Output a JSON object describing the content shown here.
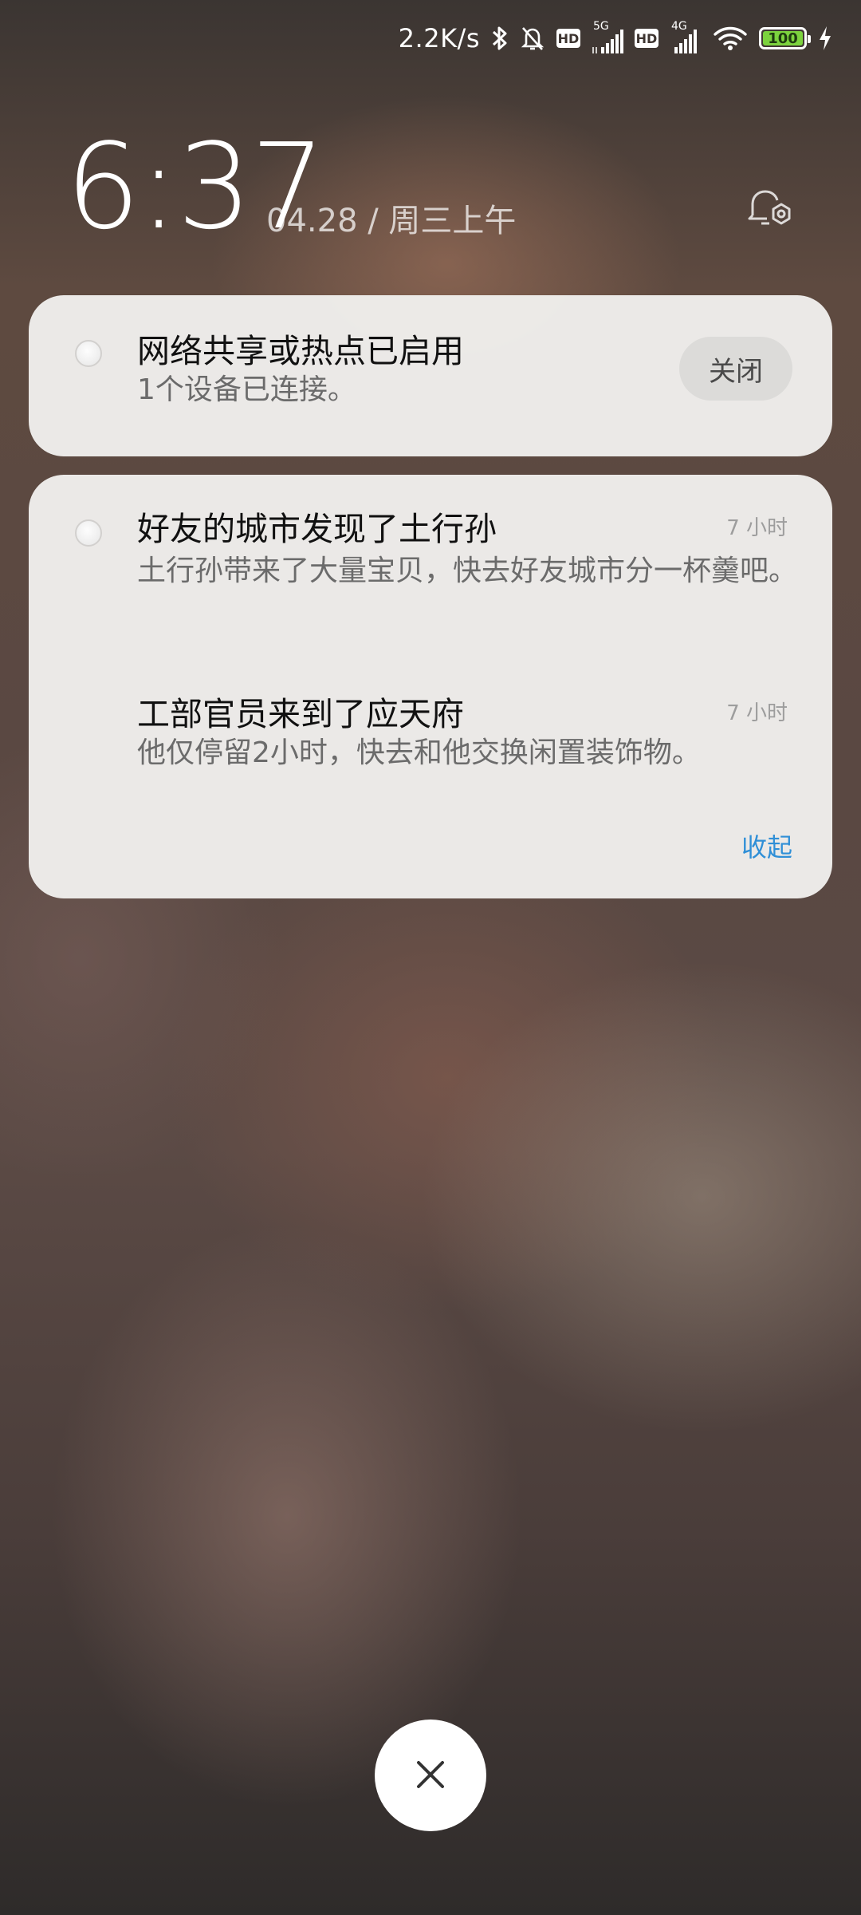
{
  "status_bar": {
    "net_speed": "2.2K/s",
    "hd1": "HD",
    "sig1_label": "5G",
    "hd2": "HD",
    "sig2_label": "4G",
    "battery": "100",
    "icons": [
      "bluetooth-icon",
      "bell-off-icon",
      "hd-icon",
      "signal-icon",
      "hd-icon",
      "signal-icon",
      "wifi-icon",
      "battery-icon",
      "charging-icon"
    ],
    "battery_color": "#7cd33e"
  },
  "lockscreen": {
    "time": "6:37",
    "date": "04.28 / 周三上午"
  },
  "notifications": {
    "hotspot": {
      "title": "网络共享或热点已启用",
      "body": "1个设备已连接。",
      "close_label": "关闭"
    },
    "game": [
      {
        "title": "好友的城市发现了土行孙",
        "body": "土行孙带来了大量宝贝，快去好友城市分一杯羹吧。",
        "time": "7 小时"
      },
      {
        "title": "工部官员来到了应天府",
        "body": "他仅停留2小时，快去和他交换闲置装饰物。",
        "time": "7 小时"
      }
    ],
    "collapse_label": "收起",
    "accent_color": "#2f8fd7"
  },
  "dismiss": {
    "icon": "close-icon"
  }
}
